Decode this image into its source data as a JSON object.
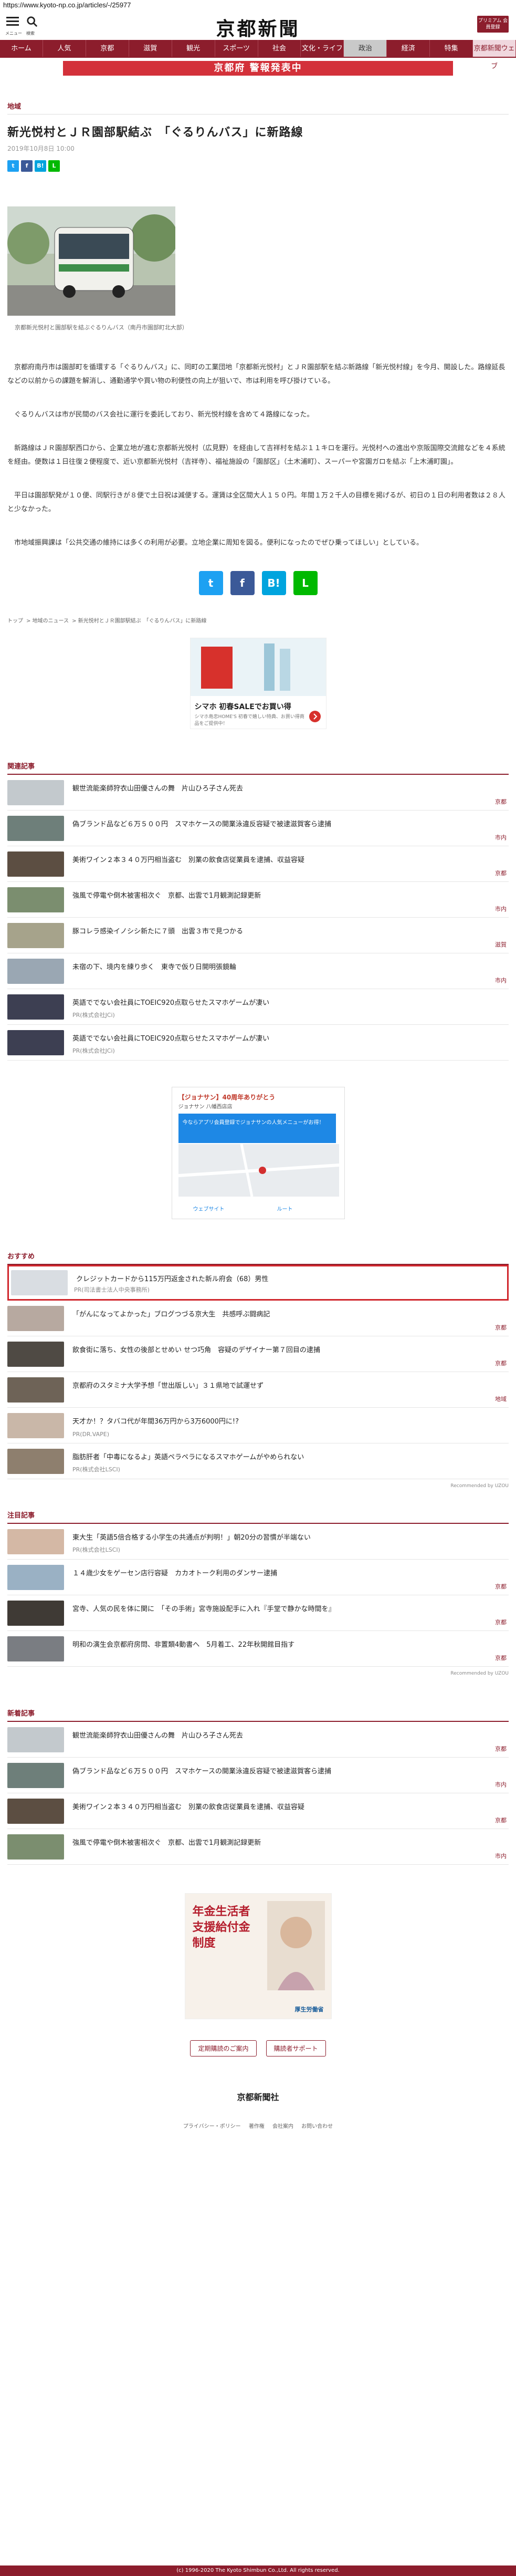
{
  "url": "https://www.kyoto-np.co.jp/articles/-/25977",
  "header": {
    "menu_label": "メニュー",
    "search_label": "検索",
    "logo": "京都新聞",
    "premium": "プリミアム 会員登録"
  },
  "gnav": [
    "ホーム",
    "人気",
    "京都",
    "滋賀",
    "観光",
    "スポーツ",
    "社会",
    "文化・ライフ",
    "政治",
    "経済",
    "特集",
    "京都新聞ウェブ"
  ],
  "alert": "京都府  警報発表中",
  "article": {
    "category": "地域",
    "title": "新光悦村とＪＲ園部駅結ぶ　「ぐるりんバス」に新路線",
    "date": "2019年10月8日 10:00",
    "caption": "京都新光悦村と園部駅を結ぶぐるりんバス（南丹市園部町北大部）",
    "paragraphs": [
      "京都府南丹市は園部町を循環する「ぐるりんバス」に、同町の工業団地「京都新光悦村」とＪＲ園部駅を結ぶ新路線「新光悦村線」を今月、開設した。路線延長などの以前からの課題を解消し、通勤通学や買い物の利便性の向上が狙いで、市は利用を呼び掛けている。",
      "ぐるりんバスは市が民間のバス会社に運行を委託しており、新光悦村線を含めて４路線になった。",
      "新路線はＪＲ園部駅西口から、企業立地が進む京都新光悦村（広見野）を経由して吉祥村を結ぶ１１キロを運行。光悦村への進出や京阪国際交流館などを４系統を経由。便数は１日往復２便程度で、近い京都新光悦村（吉祥寺）、福祉施設の「園部区」（土木浦町）、スーパーや宮園ガロを結ぶ「上木浦町園」。",
      "平日は園部駅発が１０便、同駅行きが８便で土日祝は減便する。運賃は全区間大人１５０円。年間１万２千人の目標を掲げるが、初日の１日の利用者数は２８人と少なかった。",
      "市地域振興課は「公共交通の維持には多くの利用が必要。立地企業に周知を図る。便利になったのでぜひ乗ってほしい」としている。"
    ]
  },
  "share": {
    "twitter": "t",
    "facebook": "f",
    "hatena": "B!",
    "line": "L"
  },
  "breadcrumb": [
    "トップ",
    "地域のニュース",
    "新光悦村とＪＲ園部駅結ぶ　「ぐるりんバス」に新路線"
  ],
  "ad1": {
    "title": "シマホ 初春SALEでお買い得",
    "text": "シマホ島忠HOME'S 初春で嬉しい特典、お買い得商品をご提供中！"
  },
  "related": {
    "title": "関連記事",
    "items": [
      {
        "title": "観世流能楽師狩衣山田優さんの舞　片山ひろ子さん死去",
        "tag": "京都"
      },
      {
        "title": "偽ブランド品など６万５００円　スマホケースの開業泳違反容疑で被逮滋賀客ら逮捕",
        "tag": "市内"
      },
      {
        "title": "美術ワイン２本３４０万円相当盗む　別業の飲食店従業員を逮捕、収益容疑",
        "tag": "京都"
      },
      {
        "title": "強風で停電や倒木被害相次ぐ　京都、出雲で1月観測記録更新",
        "tag": "市内"
      },
      {
        "title": "豚コレラ感染イノシシ新たに７頭　出雲３市で見つかる",
        "tag": "滋賀"
      },
      {
        "title": "未宿の下、境内を練り歩く　東寺で仮り日開明張鏡輪",
        "tag": "市内"
      },
      {
        "title": "英語ででない会社員にTOEIC920点取らせたスマホゲームが凄い",
        "pr": "PR(株式会社JCi)"
      },
      {
        "title": "英語ででない会社員にTOEIC920点取らせたスマホゲームが凄い",
        "pr": "PR(株式会社JCi)"
      }
    ]
  },
  "map_ad": {
    "brand": "【ジョナサン】40周年ありがとう",
    "sub": "ジョナサン 八幡西店店",
    "note": "今ならアプリ会員登録でジョナサンの人気メニューがお得！",
    "btn1": "ウェブサイト",
    "btn2": "ルート"
  },
  "recommend": {
    "title": "おすすめ",
    "items": [
      {
        "title": "クレジットカードから115万円返金された新ル府会（68）男性",
        "pr": "PR(司法書士法人中央事務所)",
        "highlight": true
      },
      {
        "title": "「がんになってよかった」ブログつづる京大生　共感呼ぶ闘病記",
        "tag": "京都"
      },
      {
        "title": "飲食街に落ち、女性の後部とせめい せつ巧角　容疑のデザイナー第７回目の逮捕",
        "tag": "京都"
      },
      {
        "title": "京都府のスタミナ大学予想「世出版しい」３１県地で試運せず",
        "tag": "地域"
      },
      {
        "title": "天才か！？タバコ代が年間36万円から3万6000円に!?",
        "pr": "PR(DR.VAPE)"
      },
      {
        "title": "脂肪肝者「中毒になるよ」英語ペラペラになるスマホゲームがやめられない",
        "pr": "PR(株式会社LSCI)"
      }
    ],
    "powered": "Recommended by UZOU"
  },
  "attention": {
    "title": "注目記事",
    "items": [
      {
        "title": "東大生「英語5倍合格する小学生の共通点が判明！」朝20分の習慣が半端ない",
        "pr": "PR(株式会社LSCI)"
      },
      {
        "title": "１４歳少女をゲーセン店行容疑　カカオトーク利用のダンサー逮捕",
        "tag": "京都"
      },
      {
        "title": "宮寺、人気の民を体に関に　「その手術」宮寺施設配手に入れ『手堂で静かな時間を』",
        "tag": "京都"
      },
      {
        "title": "明和の演生会京都府房問、非置類4動書へ　5月着工、22年秋開館目指す",
        "tag": "京都"
      }
    ],
    "powered": "Recommended by UZOU"
  },
  "latest": {
    "title": "新着記事",
    "items": [
      {
        "title": "観世流能楽師狩衣山田優さんの舞　片山ひろ子さん死去",
        "tag": "京都"
      },
      {
        "title": "偽ブランド品など６万５００円　スマホケースの開業泳違反容疑で被逮滋賀客ら逮捕",
        "tag": "市内"
      },
      {
        "title": "美術ワイン２本３４０万円相当盗む　別業の飲食店従業員を逮捕、収益容疑",
        "tag": "京都"
      },
      {
        "title": "強風で停電や倒木被害相次ぐ　京都、出雲で1月観測記録更新",
        "tag": "市内"
      }
    ]
  },
  "gov_ad": {
    "title": "年金生活者支援給付金制度",
    "brand": "厚生労働省"
  },
  "footer": {
    "links": [
      "定期購読のご案内",
      "購読者サポート"
    ],
    "logo": "京都新聞社",
    "sublinks": [
      "プライバシー・ポリシー",
      "著作権",
      "会社案内",
      "お問い合わせ"
    ],
    "copyright": "(c) 1996-2020 The Kyoto Shimbun Co.,Ltd. All rights reserved."
  }
}
